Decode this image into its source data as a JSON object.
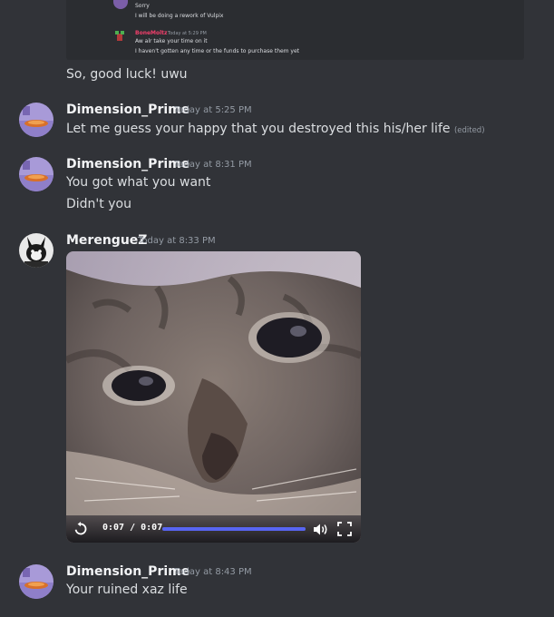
{
  "quoted_screenshot": {
    "line1": "Sorry",
    "line2": "I will be doing a rework of Vulpix",
    "reply_name": "BoneMoltz",
    "reply_ts": "Today at 5:29 PM",
    "reply_line1": "Aw alr take your time on it",
    "reply_line2": "I haven't gotten any time or the funds to purchase them yet"
  },
  "messages": [
    {
      "text": "So, good luck! uwu"
    },
    {
      "username": "Dimension_Prime",
      "timestamp": "Today at 5:25 PM",
      "text": "Let me guess your happy that you destroyed this his/her life",
      "edited": "(edited)"
    },
    {
      "username": "Dimension_Prime",
      "timestamp": "Today at 8:31 PM",
      "text": "You got what you want"
    },
    {
      "text": "Didn't you"
    },
    {
      "username": "MerengueZ",
      "timestamp": "Today at 8:33 PM"
    },
    {
      "username": "Dimension_Prime",
      "timestamp": "Today at 8:43 PM",
      "text": "Your ruined xaz life"
    }
  ],
  "video": {
    "time": "0:07 / 0:07",
    "progress": 1.0,
    "accent": "#5865f2"
  },
  "colors": {
    "background": "#313338",
    "username": "#f2f3f5",
    "text": "#dbdee1",
    "timestamp": "#949ba4"
  }
}
